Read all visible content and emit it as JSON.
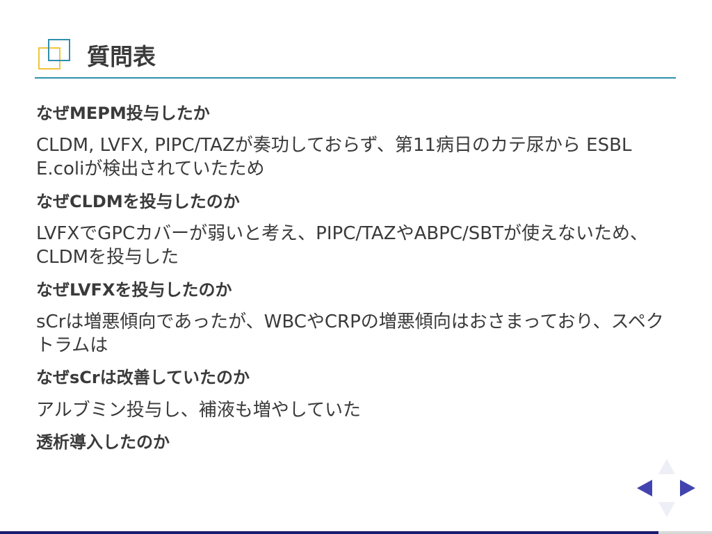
{
  "slide": {
    "title": "質問表",
    "sections": [
      {
        "question": "なぜMEPM投与したか",
        "answer": "CLDM, LVFX, PIPC/TAZが奏功しておらず、第11病日のカテ尿から ESBL E.coliが検出されていたため"
      },
      {
        "question": "なぜCLDMを投与したのか",
        "answer": "LVFXでGPCカバーが弱いと考え、PIPC/TAZやABPC/SBTが使えないため、CLDMを投与した"
      },
      {
        "question": "なぜLVFXを投与したのか",
        "answer": "sCrは増悪傾向であったが、WBCやCRPの増悪傾向はおさまっており、スペクトラムは"
      },
      {
        "question": "なぜsCrは改善していたのか",
        "answer": "アルブミン投与し、補液も増やしていた"
      },
      {
        "question": "透析導入したのか",
        "answer": ""
      }
    ]
  },
  "nav": {
    "up_icon": "arrow-up-icon",
    "down_icon": "arrow-down-icon",
    "left_icon": "arrow-left-icon",
    "right_icon": "arrow-right-icon"
  },
  "progress": {
    "fraction": 0.925
  },
  "colors": {
    "accent_blue": "#2f8fad",
    "accent_yellow": "#f2c43b",
    "nav_active": "#4343b0",
    "nav_inactive": "#eeeef6",
    "text": "#3a3a3a"
  }
}
